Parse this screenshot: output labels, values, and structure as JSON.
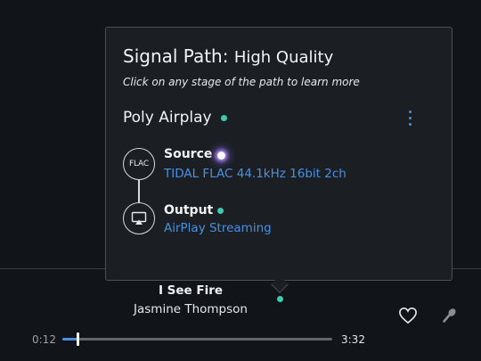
{
  "popover": {
    "title_prefix": "Signal Path:",
    "title_quality": "High Quality",
    "hint": "Click on any stage of the path to learn more",
    "device": {
      "name": "Poly Airplay",
      "status_color": "#3fc9b0",
      "menu_icon": "more-vertical-icon"
    },
    "stages": [
      {
        "label": "Source",
        "badge": "FLAC",
        "detail": "TIDAL FLAC 44.1kHz 16bit 2ch",
        "quality_color": "#b48cff"
      },
      {
        "label": "Output",
        "icon": "airplay-icon",
        "detail": "AirPlay Streaming",
        "quality_color": "#3fc9b0"
      }
    ]
  },
  "now_playing": {
    "title": "I See Fire",
    "artist": "Jasmine Thompson",
    "signal_indicator_color": "#3fc9b0",
    "favorite_icon": "heart-icon",
    "mic_icon": "microphone-icon"
  },
  "playback": {
    "elapsed": "0:12",
    "total": "3:32",
    "progress_fraction": 0.057
  },
  "colors": {
    "accent": "#4a90e2",
    "background": "#111418",
    "popover_bg": "#1b1f24"
  }
}
